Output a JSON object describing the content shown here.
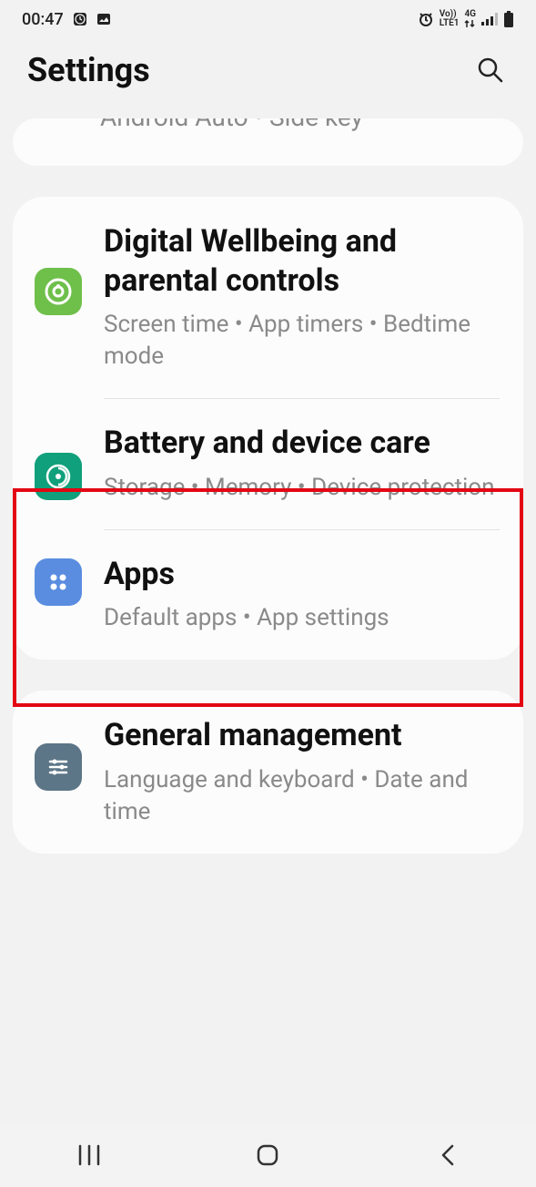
{
  "status": {
    "time": "00:47",
    "network_top": "Vo))",
    "network_bottom": "LTE1",
    "network_gen": "4G"
  },
  "header": {
    "title": "Settings"
  },
  "cutoff": {
    "text": "Android Auto  •  Side key"
  },
  "items": {
    "wellbeing": {
      "title": "Digital Wellbeing and parental controls",
      "sub": "Screen time  •  App timers  •  Bedtime mode"
    },
    "battery": {
      "title": "Battery and device care",
      "sub": "Storage  •  Memory  •  Device protection"
    },
    "apps": {
      "title": "Apps",
      "sub": "Default apps  •  App settings"
    },
    "general": {
      "title": "General management",
      "sub": "Language and keyboard  •  Date and time"
    }
  }
}
